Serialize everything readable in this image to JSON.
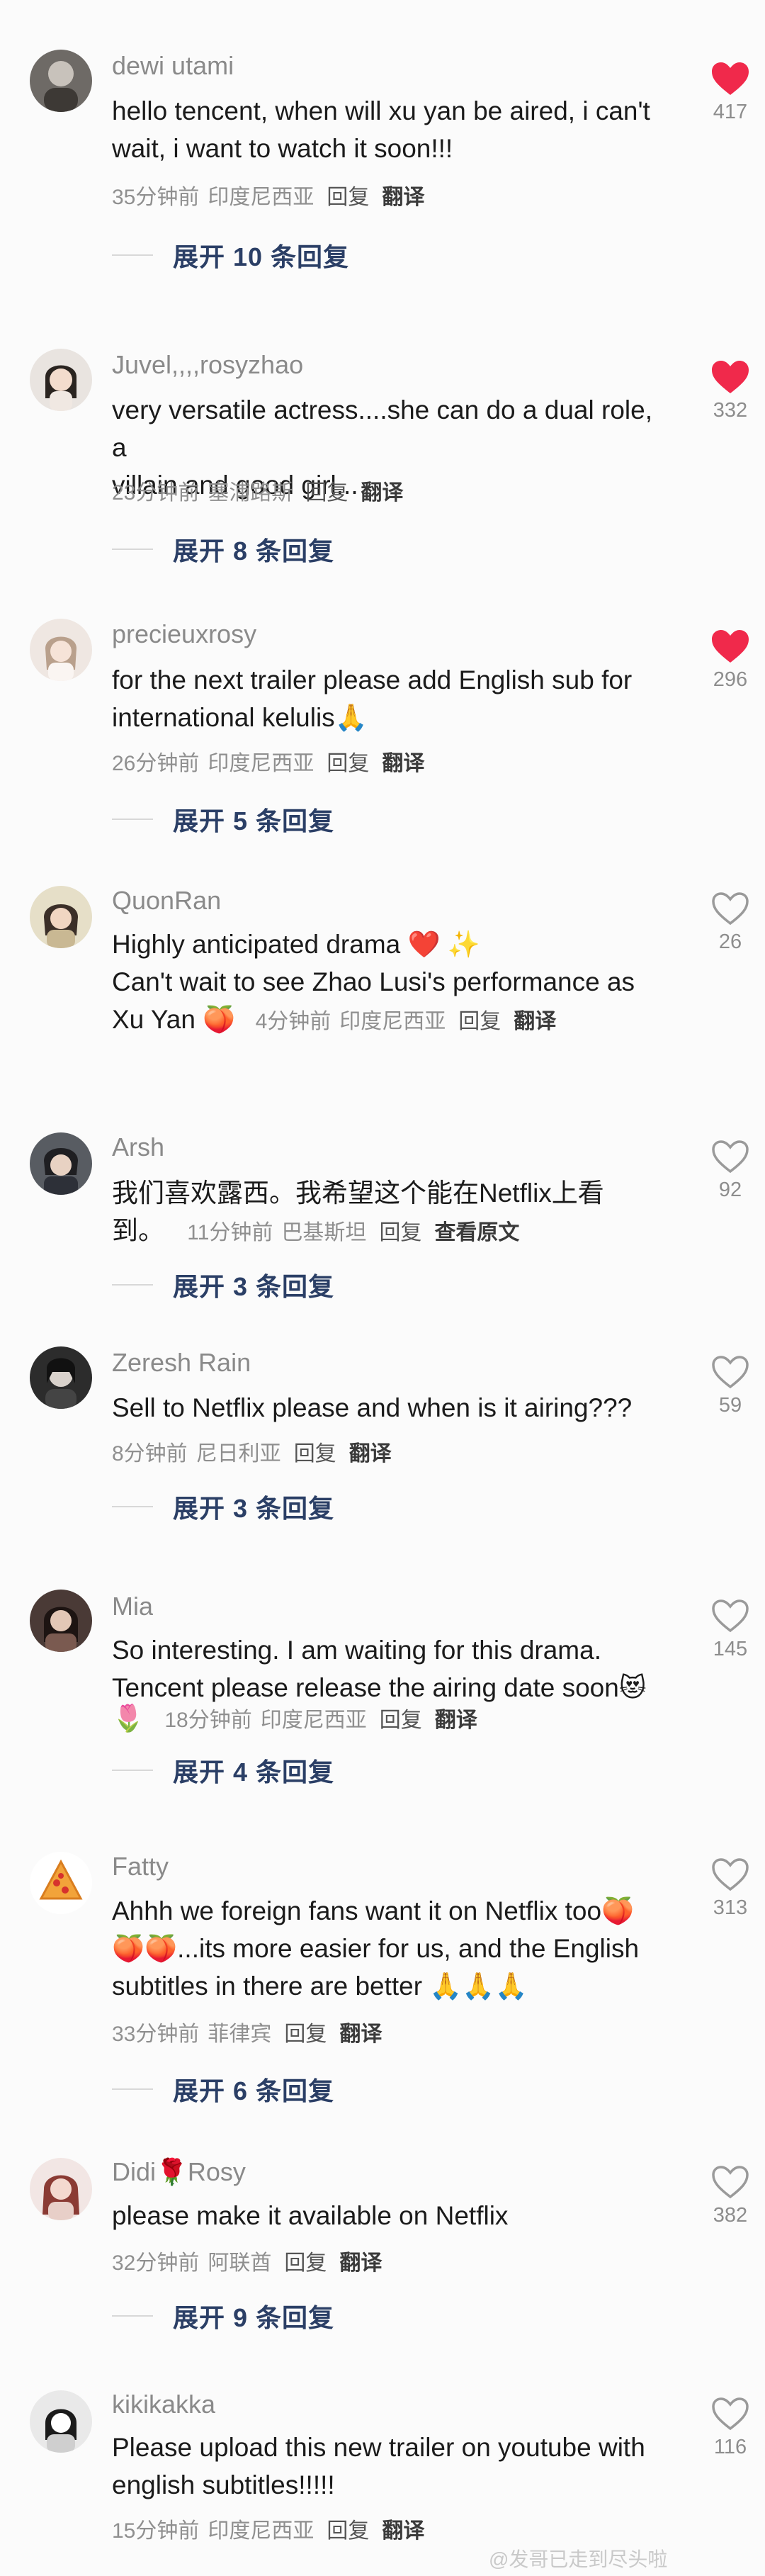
{
  "comments": [
    {
      "username": "dewi utami",
      "lines": [
        "hello tencent, when will xu yan be aired, i can't",
        "wait, i want to watch it soon!!!"
      ],
      "time": "35分钟前",
      "location": "印度尼西亚",
      "reply": "回复",
      "action": "翻译",
      "likes": "417",
      "liked": true,
      "expand": "展开 10 条回复"
    },
    {
      "username": "Juvel,,,,rosyzhao",
      "lines": [
        "very versatile actress....she can do a dual role, a",
        "villain and good girl..."
      ],
      "time": "23分钟前",
      "location": "塞浦路斯",
      "reply": "回复",
      "action": "翻译",
      "likes": "332",
      "liked": true,
      "expand": "展开 8 条回复"
    },
    {
      "username": "precieuxrosy",
      "lines": [
        "for the next trailer please add English sub for",
        "international kelulis🙏"
      ],
      "time": "26分钟前",
      "location": "印度尼西亚",
      "reply": "回复",
      "action": "翻译",
      "likes": "296",
      "liked": true,
      "expand": "展开 5 条回复"
    },
    {
      "username": "QuonRan",
      "lines": [
        "Highly anticipated drama ❤️ ✨",
        "Can't wait to see Zhao Lusi's performance as"
      ],
      "inline_text": "Xu Yan 🍑",
      "time": "4分钟前",
      "location": "印度尼西亚",
      "reply": "回复",
      "action": "翻译",
      "likes": "26",
      "liked": false
    },
    {
      "username": "Arsh",
      "lines": [
        "我们喜欢露西。我希望这个能在Netflix上看"
      ],
      "inline_text": "到。",
      "time": "11分钟前",
      "location": "巴基斯坦",
      "reply": "回复",
      "action": "查看原文",
      "likes": "92",
      "liked": false,
      "expand": "展开 3 条回复"
    },
    {
      "username": "Zeresh Rain",
      "lines": [
        "Sell to Netflix please and when is it airing???"
      ],
      "time": "8分钟前",
      "location": "尼日利亚",
      "reply": "回复",
      "action": "翻译",
      "likes": "59",
      "liked": false,
      "expand": "展开 3 条回复"
    },
    {
      "username": "Mia",
      "lines": [
        "So interesting. I am waiting for this drama.",
        "Tencent please release the airing date soon😻"
      ],
      "inline_text": "🌷",
      "time": "18分钟前",
      "location": "印度尼西亚",
      "reply": "回复",
      "action": "翻译",
      "likes": "145",
      "liked": false,
      "expand": "展开 4 条回复"
    },
    {
      "username": "Fatty",
      "lines": [
        "Ahhh we foreign fans want it on Netflix too🍑",
        "🍑🍑...its more easier for us, and the English",
        "subtitles  in there are better 🙏🙏🙏"
      ],
      "time": "33分钟前",
      "location": "菲律宾",
      "reply": "回复",
      "action": "翻译",
      "likes": "313",
      "liked": false,
      "expand": "展开 6 条回复"
    },
    {
      "username": "Didi🌹Rosy",
      "lines": [
        "please make it available on Netflix"
      ],
      "time": "32分钟前",
      "location": "阿联酋",
      "reply": "回复",
      "action": "翻译",
      "likes": "382",
      "liked": false,
      "expand": "展开 9 条回复"
    },
    {
      "username": "kikikakka",
      "lines": [
        "Please upload this new trailer on youtube with",
        "english subtitles!!!!!"
      ],
      "time": "15分钟前",
      "location": "印度尼西亚",
      "reply": "回复",
      "action": "翻译",
      "likes": "116",
      "liked": false
    }
  ],
  "watermark": "@发哥已走到尽头啦",
  "colors": {
    "liked": "#f0294b",
    "unliked": "#9a9a9a",
    "translate": "#3a3a3a",
    "expand": "#2b3f66"
  }
}
